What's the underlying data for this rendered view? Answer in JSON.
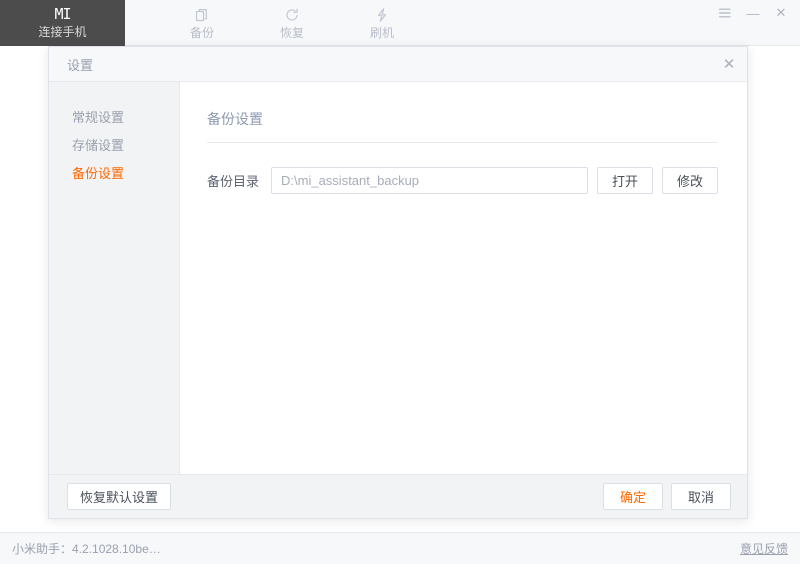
{
  "window": {
    "logo": {
      "mark": "MI",
      "label": "连接手机"
    },
    "nav": [
      {
        "label": "备份",
        "icon": "copy-stack-icon"
      },
      {
        "label": "恢复",
        "icon": "circular-restore-icon"
      },
      {
        "label": "刷机",
        "icon": "lightning-bolt-icon"
      }
    ],
    "controls": {
      "menu": "menu-list-icon",
      "minimize": "—",
      "close": "✕"
    }
  },
  "statusbar": {
    "version": "小米助手：4.2.1028.10be…",
    "feedback": "意见反馈"
  },
  "dialog": {
    "title": "设置",
    "close": "✕",
    "sidebar": [
      {
        "label": "常规设置",
        "active": false
      },
      {
        "label": "存储设置",
        "active": false
      },
      {
        "label": "备份设置",
        "active": true
      }
    ],
    "section_title": "备份设置",
    "field": {
      "label": "备份目录",
      "value": "D:\\mi_assistant_backup",
      "placeholder": "D:\\mi_assistant_backup",
      "open_button": "打开",
      "modify_button": "修改"
    },
    "footer": {
      "reset": "恢复默认设置",
      "ok": "确定",
      "cancel": "取消"
    }
  },
  "colors": {
    "accent": "#ff6700",
    "logo_bg": "#4c4c4c",
    "panel_bg": "#f2f3f5",
    "topbar_bg": "#f7f8fa"
  }
}
